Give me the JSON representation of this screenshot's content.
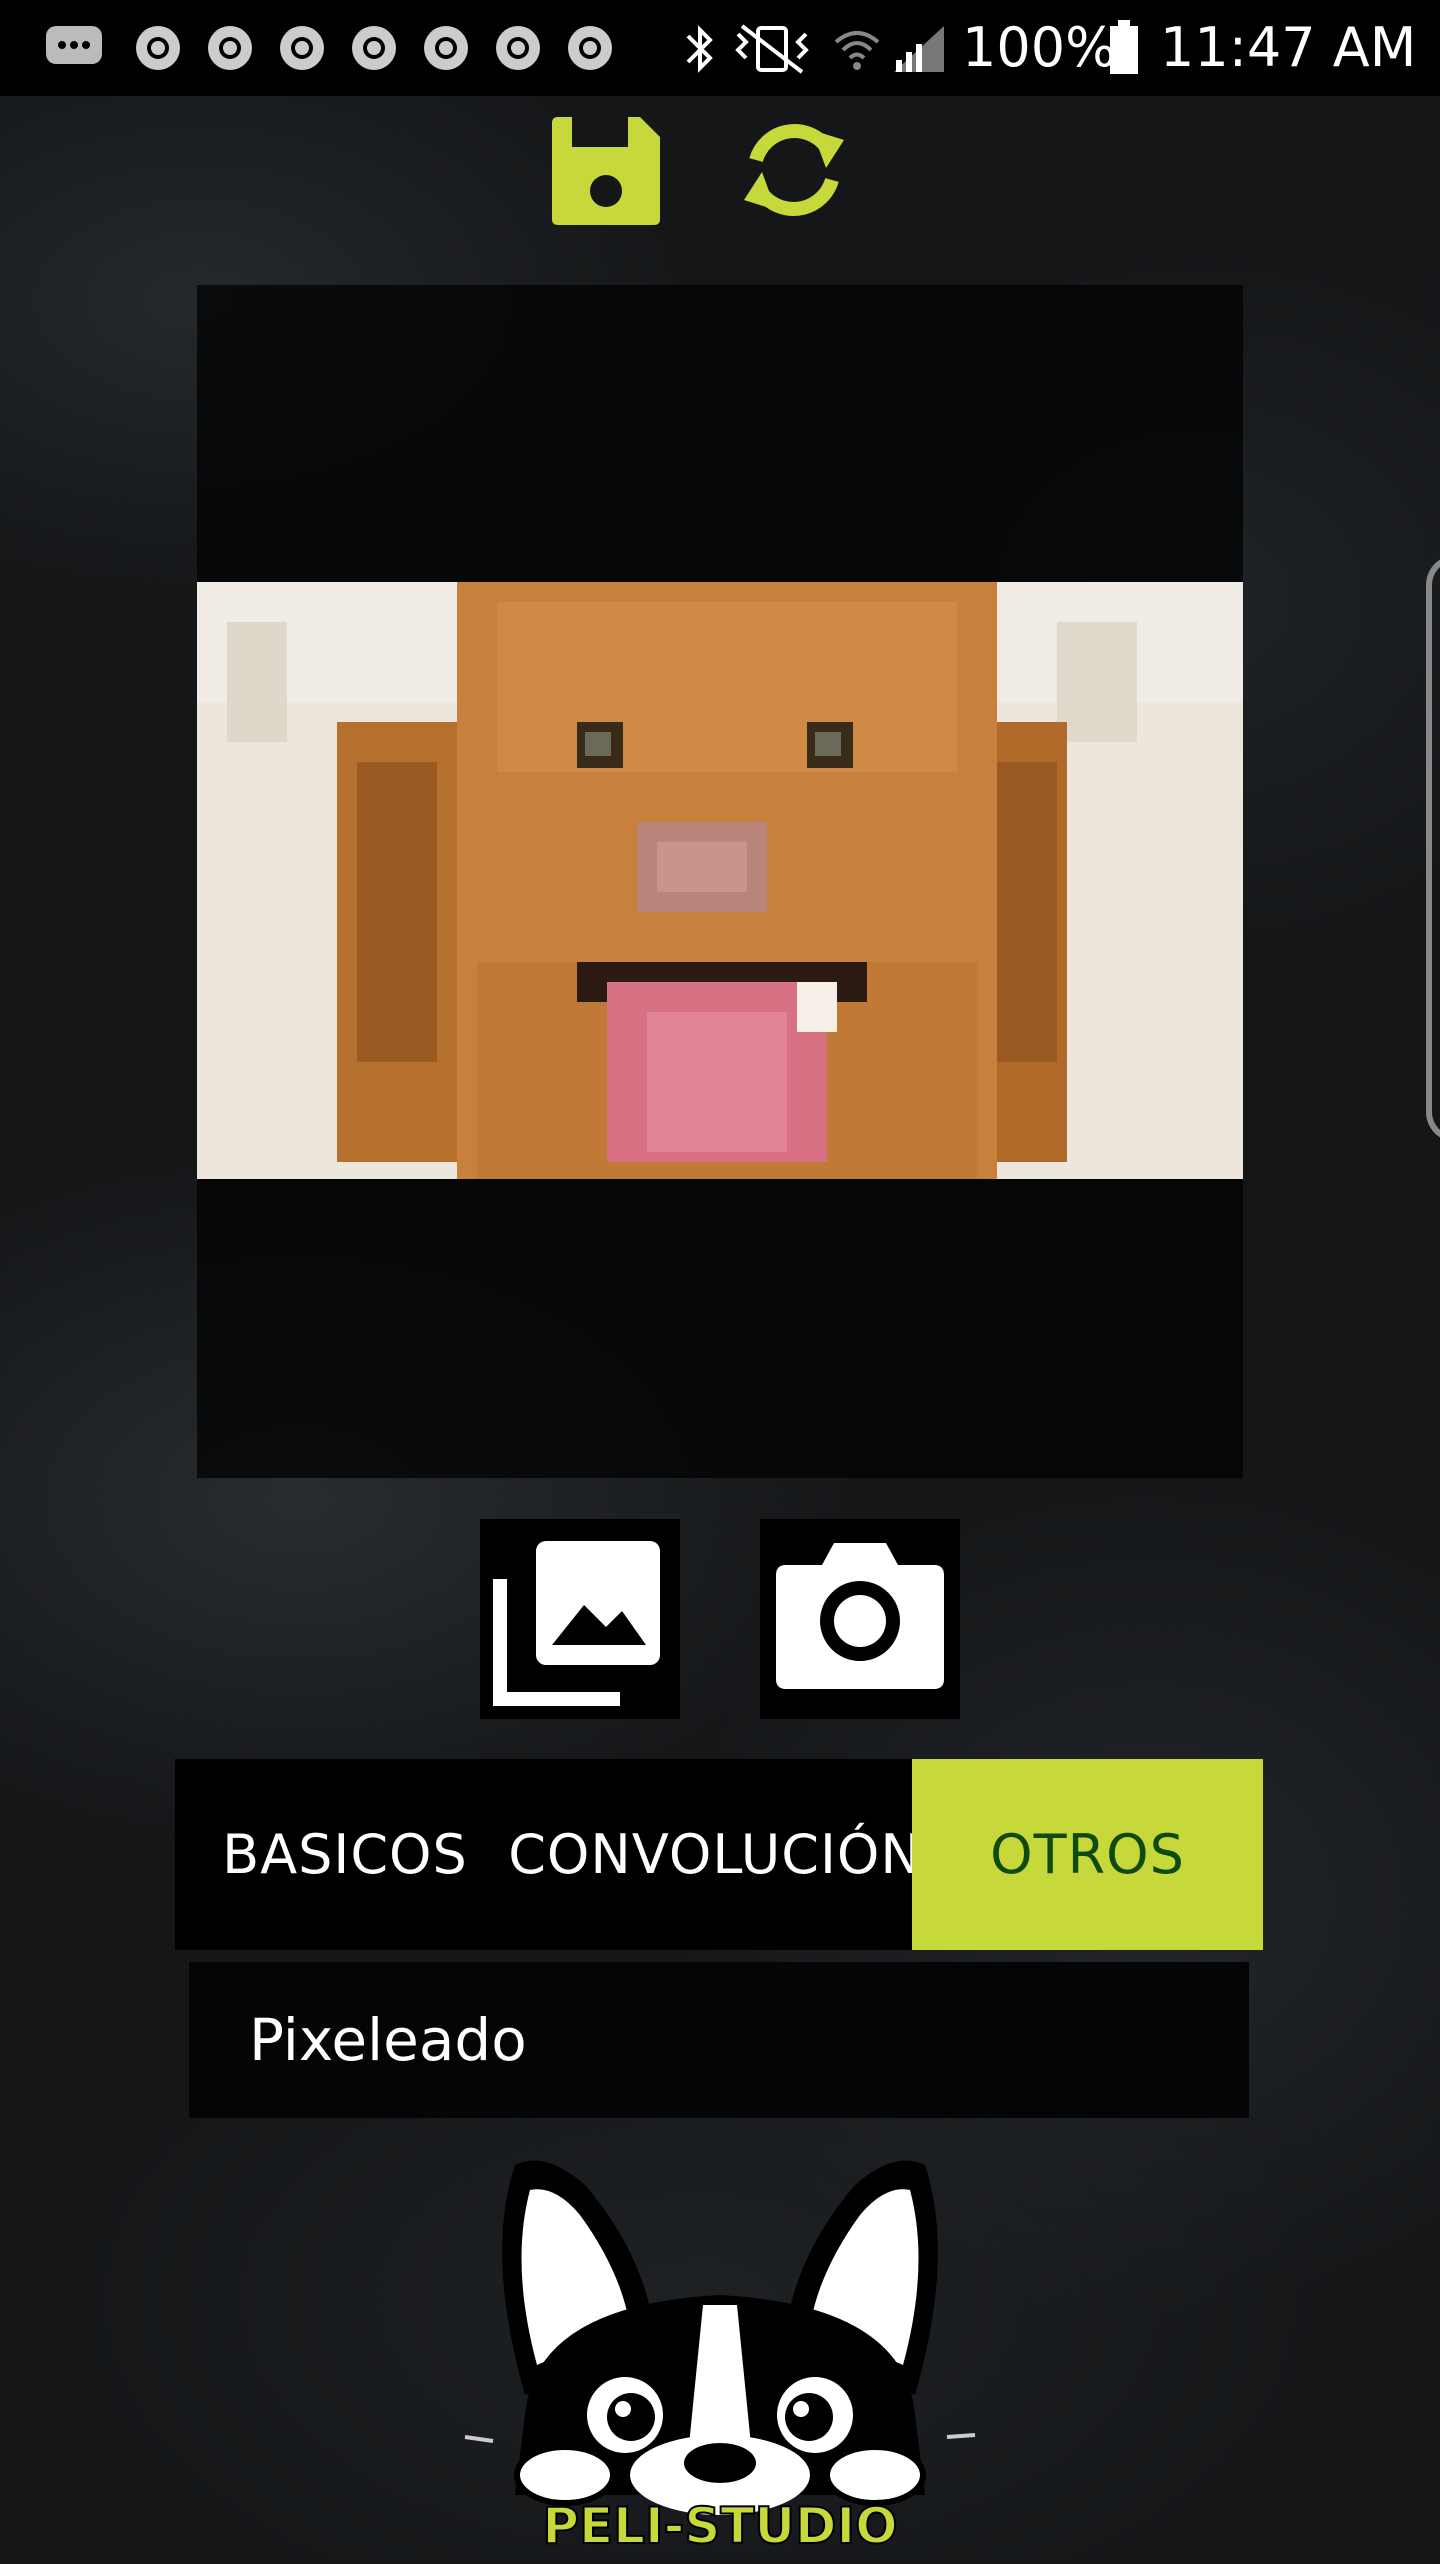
{
  "status_bar": {
    "battery": "100%",
    "time": "11:47 AM",
    "icons": [
      "message-icon",
      "chrome-icon",
      "chrome-icon",
      "chrome-icon",
      "chrome-icon",
      "chrome-icon",
      "chrome-icon",
      "chrome-icon",
      "bluetooth-icon",
      "vibrate-icon",
      "wifi-icon",
      "signal-icon",
      "battery-icon"
    ]
  },
  "toolbar": {
    "save_icon": "save-icon",
    "refresh_icon": "refresh-icon",
    "accent_color": "#c7d93a"
  },
  "preview": {
    "image": "pixelated dog photo"
  },
  "source_buttons": {
    "gallery_icon": "gallery-icon",
    "camera_icon": "camera-icon"
  },
  "tabs": [
    {
      "label": "BASICOS",
      "active": false
    },
    {
      "label": "CONVOLUCIÓN",
      "active": false
    },
    {
      "label": "OTROS",
      "active": true
    }
  ],
  "filters": {
    "items": [
      "Pixeleado"
    ]
  },
  "logo": {
    "text": "PELI-STUDIO"
  },
  "colors": {
    "accent": "#c7d93a",
    "active_tab_text": "#0f4a12",
    "background": "#141618"
  }
}
